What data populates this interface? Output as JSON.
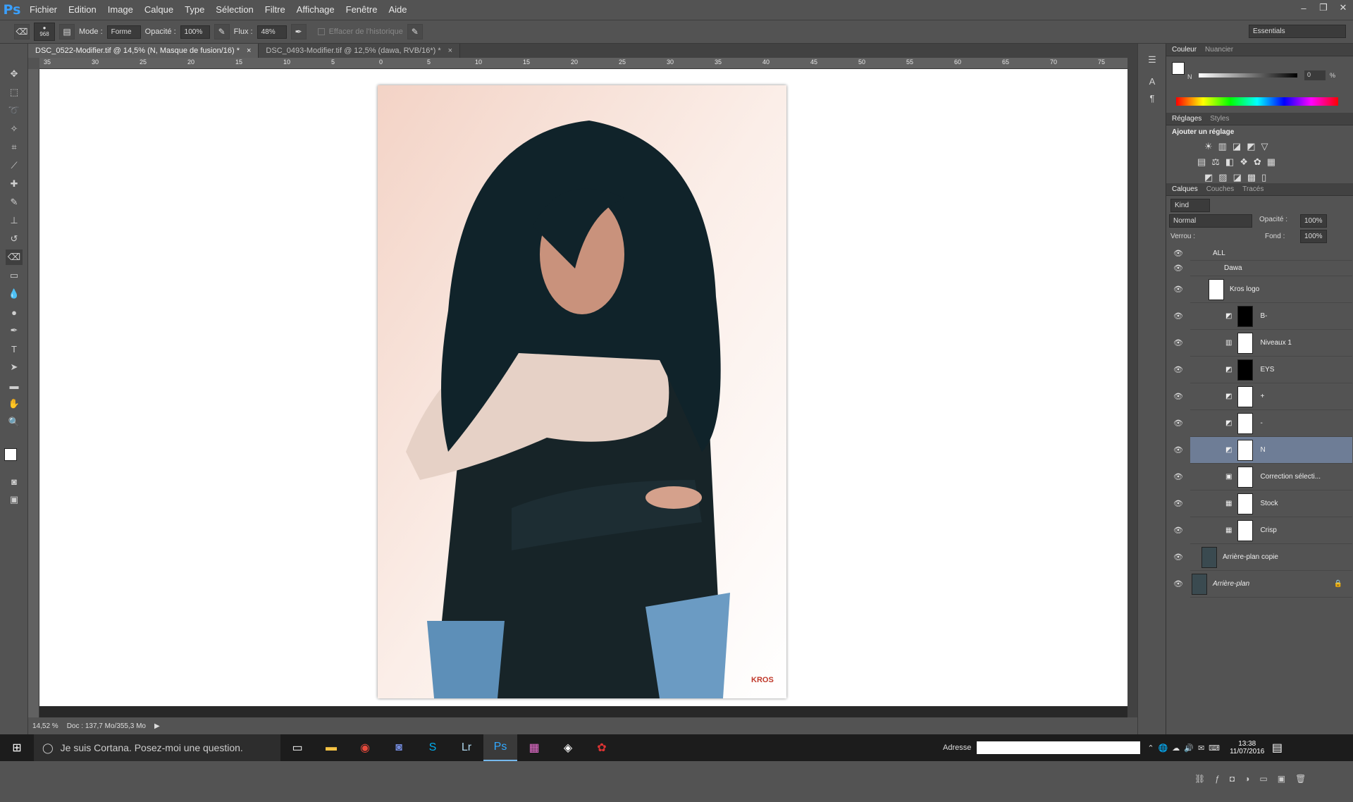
{
  "app": {
    "logo": "Ps"
  },
  "menu": [
    "Fichier",
    "Edition",
    "Image",
    "Calque",
    "Type",
    "Sélection",
    "Filtre",
    "Affichage",
    "Fenêtre",
    "Aide"
  ],
  "options": {
    "brush_size": "968",
    "mode_label": "Mode :",
    "mode_value": "Forme",
    "opacity_label": "Opacité :",
    "opacity_value": "100%",
    "flux_label": "Flux :",
    "flux_value": "48%",
    "history_label": "Effacer de l'historique",
    "workspace": "Essentials"
  },
  "tabs": [
    {
      "label": "DSC_0522-Modifier.tif @ 14,5% (N, Masque de fusion/16) *",
      "close": "×"
    },
    {
      "label": "DSC_0493-Modifier.tif @ 12,5% (dawa, RVB/16*) *",
      "close": "×"
    }
  ],
  "ruler": [
    "35",
    "30",
    "25",
    "20",
    "15",
    "10",
    "5",
    "0",
    "5",
    "10",
    "15",
    "20",
    "25",
    "30",
    "35",
    "40",
    "45",
    "50",
    "55",
    "60",
    "65",
    "70",
    "75"
  ],
  "status": {
    "zoom": "14,52 %",
    "doc": "Doc : 137,7 Mo/355,3 Mo"
  },
  "watermark": "KROS",
  "panels": {
    "color": {
      "tab1": "Couleur",
      "tab2": "Nuancier",
      "channel": "N",
      "value": "0",
      "unit": "%"
    },
    "adjust": {
      "tab1": "Réglages",
      "tab2": "Styles",
      "title": "Ajouter un réglage"
    },
    "layers": {
      "tab1": "Calques",
      "tab2": "Couches",
      "tab3": "Tracés",
      "kind": "Kind",
      "blend": "Normal",
      "opacity_label": "Opacité :",
      "opacity_value": "100%",
      "lock_label": "Verrou :",
      "fill_label": "Fond :",
      "fill_value": "100%",
      "items": [
        {
          "name": "ALL"
        },
        {
          "name": "Dawa"
        },
        {
          "name": "Kros logo"
        },
        {
          "name": "B-"
        },
        {
          "name": "Niveaux 1"
        },
        {
          "name": "EYS"
        },
        {
          "name": "+"
        },
        {
          "name": "-"
        },
        {
          "name": "N"
        },
        {
          "name": "Correction sélecti..."
        },
        {
          "name": "Stock"
        },
        {
          "name": "Crisp"
        },
        {
          "name": "Arrière-plan copie"
        },
        {
          "name": "Arrière-plan"
        }
      ]
    }
  },
  "taskbar": {
    "cortana": "Je suis Cortana. Posez-moi une question.",
    "address_label": "Adresse",
    "time": "13:38",
    "date": "11/07/2016"
  }
}
